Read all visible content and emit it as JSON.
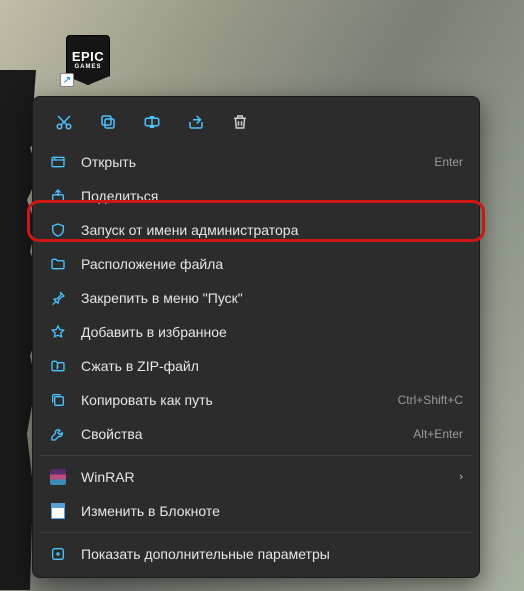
{
  "desktop": {
    "icon_text1": "EPIC",
    "icon_text2": "GAMES"
  },
  "menu": {
    "open": "Открыть",
    "open_key": "Enter",
    "share": "Поделиться",
    "run_admin": "Запуск от имени администратора",
    "file_loc": "Расположение файла",
    "pin_start": "Закрепить в меню \"Пуск\"",
    "add_fav": "Добавить в избранное",
    "zip": "Сжать в ZIP-файл",
    "copy_path": "Копировать как путь",
    "copy_path_key": "Ctrl+Shift+C",
    "props": "Свойства",
    "props_key": "Alt+Enter",
    "winrar": "WinRAR",
    "notepad": "Изменить в Блокноте",
    "show_more": "Показать дополнительные параметры"
  }
}
